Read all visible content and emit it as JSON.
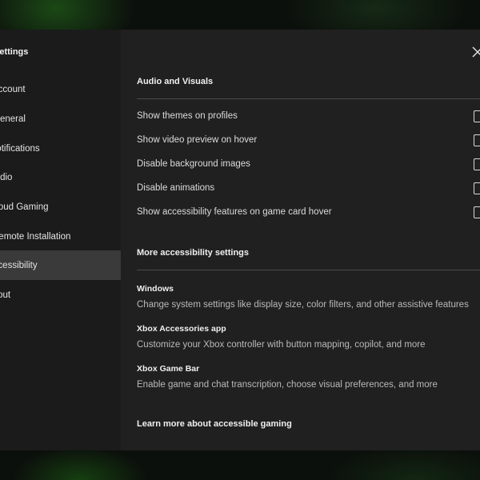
{
  "sidebar": {
    "title": "Settings",
    "items": [
      {
        "label": "Account"
      },
      {
        "label": "General"
      },
      {
        "label": "Notifications"
      },
      {
        "label": "Audio"
      },
      {
        "label": "Cloud Gaming"
      },
      {
        "label": "Remote Installation"
      },
      {
        "label": "Accessibility",
        "active": true
      },
      {
        "label": "About"
      }
    ]
  },
  "main": {
    "audio_visuals": {
      "title": "Audio and Visuals",
      "options": [
        {
          "label": "Show themes on profiles",
          "checked": false
        },
        {
          "label": "Show video preview on hover",
          "checked": false
        },
        {
          "label": "Disable background images",
          "checked": false
        },
        {
          "label": "Disable animations",
          "checked": false
        },
        {
          "label": "Show accessibility features on game card hover",
          "checked": false
        }
      ]
    },
    "more_accessibility": {
      "title": "More accessibility settings",
      "links": [
        {
          "title": "Windows",
          "description": "Change system settings like display size, color filters, and other assistive features"
        },
        {
          "title": "Xbox Accessories app",
          "description": "Customize your Xbox controller with button mapping, copilot, and more"
        },
        {
          "title": "Xbox Game Bar",
          "description": "Enable game and chat transcription, choose visual preferences, and more"
        }
      ]
    },
    "learn_more": {
      "label": "Learn more about accessible gaming"
    }
  },
  "icons": {
    "close": "close-icon"
  }
}
